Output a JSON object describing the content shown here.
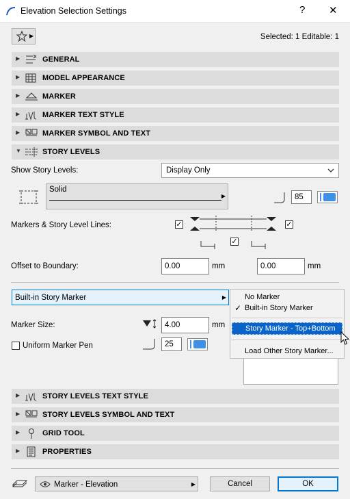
{
  "window": {
    "title": "Elevation Selection Settings",
    "help": "?",
    "close": "✕"
  },
  "header": {
    "selected_info": "Selected: 1 Editable: 1"
  },
  "sections_top": [
    {
      "label": "GENERAL",
      "expanded": false
    },
    {
      "label": "MODEL APPEARANCE",
      "expanded": false
    },
    {
      "label": "MARKER",
      "expanded": false
    },
    {
      "label": "MARKER TEXT STYLE",
      "expanded": false
    },
    {
      "label": "MARKER SYMBOL AND TEXT",
      "expanded": false
    },
    {
      "label": "STORY LEVELS",
      "expanded": true
    }
  ],
  "story_levels": {
    "show_label": "Show Story Levels:",
    "show_value": "Display Only",
    "line_type": "Solid",
    "pen_number": "85",
    "markers_label": "Markers & Story Level Lines:",
    "offset_label": "Offset to Boundary:",
    "offset_left": "0.00",
    "offset_right": "0.00",
    "unit": "mm",
    "marker_type": "Built-in Story Marker",
    "marker_size_label": "Marker Size:",
    "marker_size": "4.00",
    "uniform_pen_label": "Uniform Marker Pen",
    "marker_pen": "25"
  },
  "context_menu": {
    "items": [
      {
        "label": "No Marker",
        "checked": false,
        "highlighted": false
      },
      {
        "label": "Built-in Story Marker",
        "checked": true,
        "highlighted": false
      },
      {
        "label": "Story Marker - Top+Bottom",
        "checked": false,
        "highlighted": true
      },
      {
        "label": "Load Other Story Marker...",
        "checked": false,
        "highlighted": false
      }
    ]
  },
  "sections_bottom": [
    {
      "label": "STORY LEVELS TEXT STYLE",
      "expanded": false
    },
    {
      "label": "STORY LEVELS SYMBOL AND TEXT",
      "expanded": false
    },
    {
      "label": "GRID TOOL",
      "expanded": false
    },
    {
      "label": "PROPERTIES",
      "expanded": false
    }
  ],
  "footer": {
    "layer": "Marker - Elevation",
    "cancel": "Cancel",
    "ok": "OK"
  },
  "colors": {
    "accent": "#0078d7",
    "highlight": "#0a64c8",
    "pen_blue": "#3e8fe6",
    "section_bg": "#dcdcdc"
  },
  "icons": [
    "archicad-logo-icon",
    "star-icon",
    "general-icon",
    "model-appearance-icon",
    "marker-icon",
    "marker-text-style-icon",
    "marker-symbol-text-icon",
    "story-levels-icon",
    "grid-tool-icon",
    "properties-icon",
    "layer-icon",
    "eye-icon",
    "pen-icon",
    "cursor-icon"
  ]
}
